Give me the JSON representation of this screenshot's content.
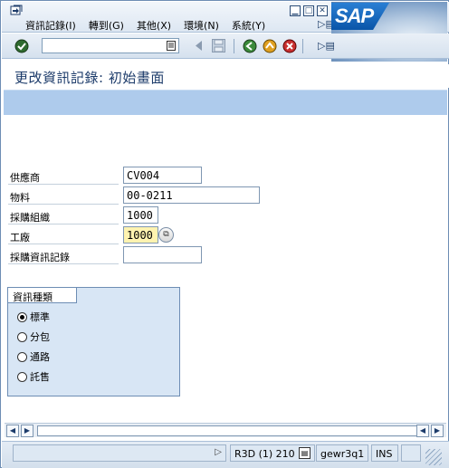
{
  "menubar": {
    "items": [
      "資訊記錄(I)",
      "轉到(G)",
      "其他(X)",
      "環境(N)",
      "系統(Y)"
    ],
    "overflow_icon": "menu-overflow-icon",
    "window_controls": [
      "minimize-icon",
      "maximize-icon",
      "close-icon"
    ],
    "logo_text": "SAP"
  },
  "toolbar": {
    "command_value": "",
    "icons": [
      "enter-icon",
      "command-history-icon",
      "back-arrow-icon",
      "save-icon",
      "back-icon",
      "exit-icon",
      "cancel-icon",
      "toolbar-overflow-icon"
    ]
  },
  "title": "更改資訊記錄: 初始畫面",
  "form": {
    "vendor": {
      "label": "供應商",
      "value": "CV004"
    },
    "material": {
      "label": "物料",
      "value": "00-0211"
    },
    "purch_org": {
      "label": "採購組織",
      "value": "1000"
    },
    "plant": {
      "label": "工廠",
      "value": "1000"
    },
    "info_record": {
      "label": "採購資訊記錄",
      "value": ""
    }
  },
  "group": {
    "title": "資訊種類",
    "options": [
      {
        "label": "標準",
        "selected": true
      },
      {
        "label": "分包",
        "selected": false
      },
      {
        "label": "通路",
        "selected": false
      },
      {
        "label": "託售",
        "selected": false
      }
    ]
  },
  "statusbar": {
    "system": "R3D (1) 210",
    "server": "gewr3q1",
    "mode": "INS"
  },
  "colors": {
    "accent": "#aecbec",
    "border": "#6d8db4",
    "required_field": "#fff3b0",
    "title_text": "#1c3b6a"
  }
}
